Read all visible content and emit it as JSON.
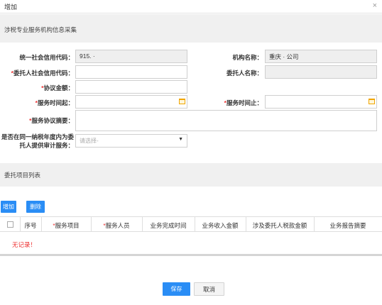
{
  "dialog": {
    "title": "增加",
    "close_icon": "×"
  },
  "section1": {
    "title": "涉税专业服务机构信息采集"
  },
  "form": {
    "credit_code": {
      "label": "统一社会信用代码：",
      "value": "915.   ·"
    },
    "org_name": {
      "label": "机构名称：",
      "value": "重庆  ·  公司"
    },
    "client_code": {
      "required": "*",
      "label": "委托人社会信用代码：",
      "value": ""
    },
    "client_name": {
      "label": "委托人名称：",
      "value": ""
    },
    "amount": {
      "required": "*",
      "label": "协议金额：",
      "value": ""
    },
    "start_time": {
      "required": "*",
      "label": "服务时间起：",
      "value": ""
    },
    "end_time": {
      "required": "*",
      "label": "服务时间止：",
      "value": ""
    },
    "summary": {
      "required": "*",
      "label": "服务协议摘要：",
      "value": ""
    },
    "audit_question": {
      "line1": "是否在同一纳税年度内为委",
      "line2": "托人提供审计服务：",
      "placeholder": "请选择-"
    }
  },
  "section2": {
    "title": "委托项目列表"
  },
  "toolbar": {
    "add_label": "增加",
    "delete_label": "删除"
  },
  "table": {
    "required_mark": "*",
    "columns": [
      "序号",
      "服务项目",
      "服务人员",
      "业务完成时间",
      "业务收入金额",
      "涉及委托人税款金额",
      "业务报告摘要"
    ],
    "empty_message": "无记录！"
  },
  "footer": {
    "save_label": "保存",
    "cancel_label": "取消"
  },
  "colors": {
    "accent": "#2a8df5",
    "required": "#e33333",
    "calendar": "#f0a500"
  }
}
